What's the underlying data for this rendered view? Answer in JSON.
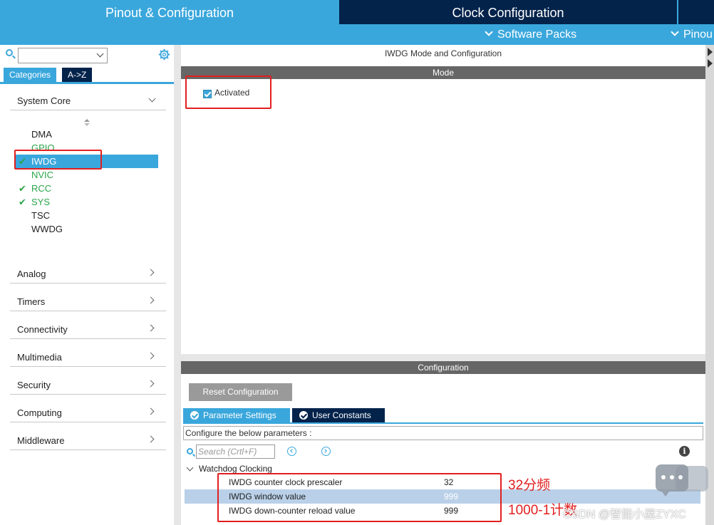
{
  "header": {
    "tab_pinout": "Pinout & Configuration",
    "tab_clock": "Clock Configuration",
    "software_packs": "Software Packs",
    "pinout_menu": "Pinou"
  },
  "left": {
    "categories_tab": "Categories",
    "az_tab": "A->Z",
    "system_core": "System Core",
    "peripherals": [
      {
        "name": "DMA",
        "checked": false,
        "style": "normal"
      },
      {
        "name": "GPIO",
        "checked": false,
        "style": "green"
      },
      {
        "name": "IWDG",
        "checked": true,
        "style": "selected"
      },
      {
        "name": "NVIC",
        "checked": false,
        "style": "green"
      },
      {
        "name": "RCC",
        "checked": true,
        "style": "green"
      },
      {
        "name": "SYS",
        "checked": true,
        "style": "green"
      },
      {
        "name": "TSC",
        "checked": false,
        "style": "normal"
      },
      {
        "name": "WWDG",
        "checked": false,
        "style": "normal"
      }
    ],
    "groups": [
      "Analog",
      "Timers",
      "Connectivity",
      "Multimedia",
      "Security",
      "Computing",
      "Middleware"
    ]
  },
  "main": {
    "title": "IWDG Mode and Configuration",
    "mode_band": "Mode",
    "activated_label": "Activated",
    "activated_checked": true,
    "config_band": "Configuration",
    "reset_button": "Reset Configuration",
    "parameter_tab": "Parameter Settings",
    "user_constants_tab": "User Constants",
    "configure_text": "Configure the below parameters :",
    "search_placeholder": "Search (Crtl+F)",
    "tree_group": "Watchdog Clocking",
    "params": [
      {
        "name": "IWDG counter clock prescaler",
        "value": "32"
      },
      {
        "name": "IWDG window value",
        "value": "999"
      },
      {
        "name": "IWDG down-counter reload value",
        "value": "999"
      }
    ]
  },
  "annotations": {
    "prescaler_note": "32分频",
    "reload_note": "1000-1计数"
  },
  "watermark": "CSDN @智能小屋ZYXC",
  "colors": {
    "header_blue": "#3aa7dc",
    "dark_navy": "#03234b",
    "active_green": "#2aa54a",
    "annotation_red": "#e21f1f",
    "band_gray": "#666666"
  }
}
